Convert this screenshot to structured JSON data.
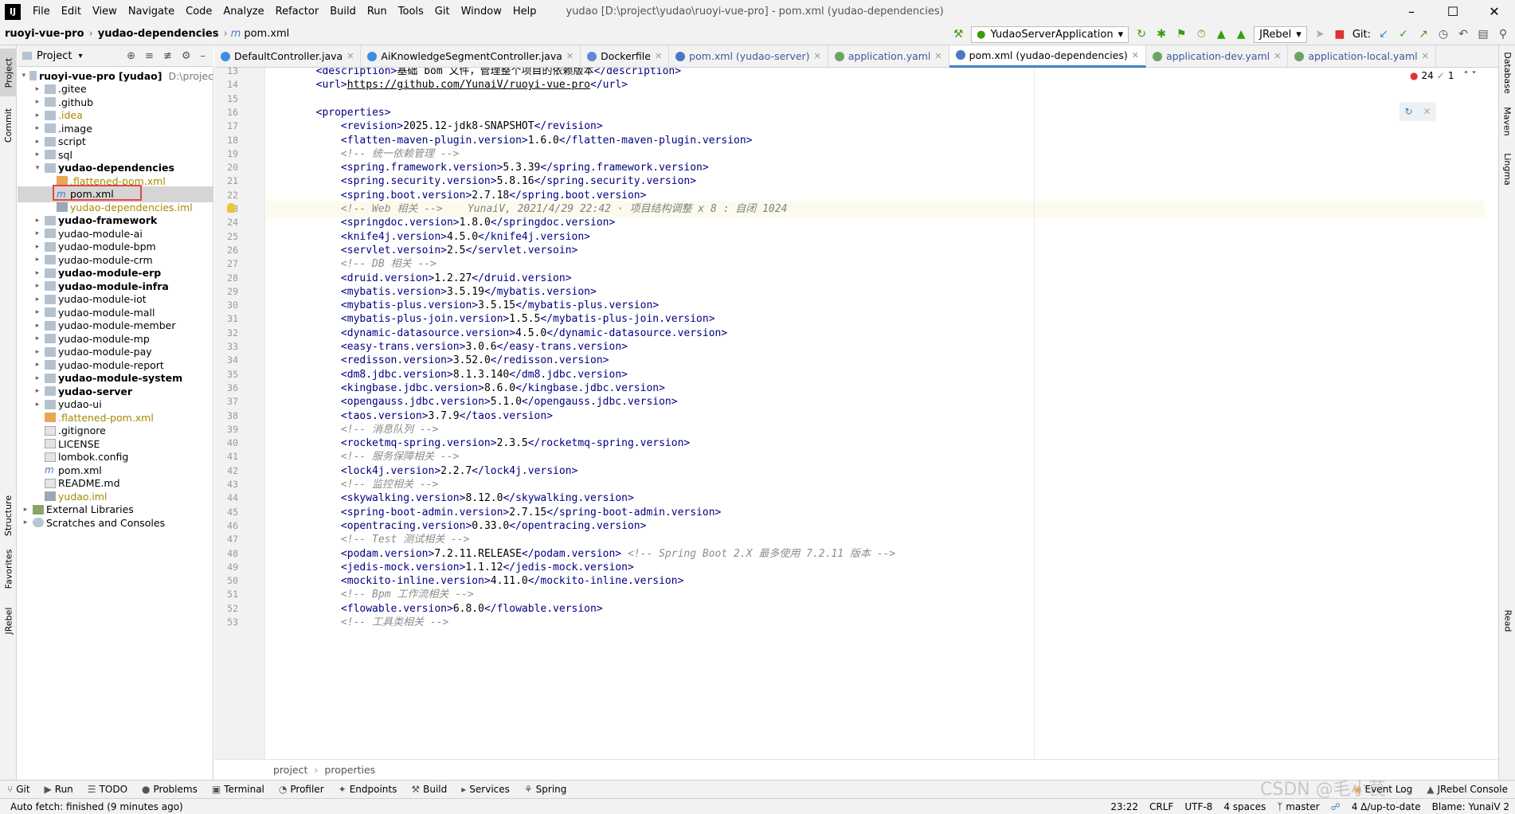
{
  "menubar": {
    "logo": "IJ",
    "items": [
      "File",
      "Edit",
      "View",
      "Navigate",
      "Code",
      "Analyze",
      "Refactor",
      "Build",
      "Run",
      "Tools",
      "Git",
      "Window",
      "Help"
    ],
    "title": "yudao [D:\\project\\yudao\\ruoyi-vue-pro] - pom.xml (yudao-dependencies)"
  },
  "navbar": {
    "crumbs": [
      "ruoyi-vue-pro",
      "yudao-dependencies",
      "pom.xml"
    ],
    "run_config": "YudaoServerApplication",
    "jrebel": "JRebel",
    "git_label": "Git:"
  },
  "left_strip": {
    "tabs": [
      "Project",
      "Commit",
      "Structure",
      "Favorites",
      "JRebel"
    ]
  },
  "right_strip": {
    "tabs": [
      "Database",
      "Maven",
      "Lingma",
      "Read"
    ]
  },
  "project_panel": {
    "title": "Project"
  },
  "tree": [
    {
      "label": "ruoyi-vue-pro [yudao]",
      "suffix": "D:\\projec",
      "depth": 0,
      "arrow": "open",
      "kind": "folder",
      "style": "bold"
    },
    {
      "label": ".gitee",
      "depth": 1,
      "arrow": "closed",
      "kind": "folder",
      "style": ""
    },
    {
      "label": ".github",
      "depth": 1,
      "arrow": "closed",
      "kind": "folder",
      "style": ""
    },
    {
      "label": ".idea",
      "depth": 1,
      "arrow": "closed",
      "kind": "folder",
      "style": "olive"
    },
    {
      "label": ".image",
      "depth": 1,
      "arrow": "closed",
      "kind": "folder",
      "style": ""
    },
    {
      "label": "script",
      "depth": 1,
      "arrow": "closed",
      "kind": "folder",
      "style": ""
    },
    {
      "label": "sql",
      "depth": 1,
      "arrow": "closed",
      "kind": "folder",
      "style": ""
    },
    {
      "label": "yudao-dependencies",
      "depth": 1,
      "arrow": "open",
      "kind": "folder",
      "style": "bold"
    },
    {
      "label": ".flattened-pom.xml",
      "depth": 2,
      "arrow": "",
      "kind": "xml",
      "style": "olive"
    },
    {
      "label": "pom.xml",
      "depth": 2,
      "arrow": "",
      "kind": "maven",
      "style": "",
      "selected": true
    },
    {
      "label": "yudao-dependencies.iml",
      "depth": 2,
      "arrow": "",
      "kind": "iml",
      "style": "olive"
    },
    {
      "label": "yudao-framework",
      "depth": 1,
      "arrow": "closed",
      "kind": "folder",
      "style": "bold"
    },
    {
      "label": "yudao-module-ai",
      "depth": 1,
      "arrow": "closed",
      "kind": "folder",
      "style": ""
    },
    {
      "label": "yudao-module-bpm",
      "depth": 1,
      "arrow": "closed",
      "kind": "folder",
      "style": ""
    },
    {
      "label": "yudao-module-crm",
      "depth": 1,
      "arrow": "closed",
      "kind": "folder",
      "style": ""
    },
    {
      "label": "yudao-module-erp",
      "depth": 1,
      "arrow": "closed",
      "kind": "folder",
      "style": "bold"
    },
    {
      "label": "yudao-module-infra",
      "depth": 1,
      "arrow": "closed",
      "kind": "folder",
      "style": "bold"
    },
    {
      "label": "yudao-module-iot",
      "depth": 1,
      "arrow": "closed",
      "kind": "folder",
      "style": ""
    },
    {
      "label": "yudao-module-mall",
      "depth": 1,
      "arrow": "closed",
      "kind": "folder",
      "style": ""
    },
    {
      "label": "yudao-module-member",
      "depth": 1,
      "arrow": "closed",
      "kind": "folder",
      "style": ""
    },
    {
      "label": "yudao-module-mp",
      "depth": 1,
      "arrow": "closed",
      "kind": "folder",
      "style": ""
    },
    {
      "label": "yudao-module-pay",
      "depth": 1,
      "arrow": "closed",
      "kind": "folder",
      "style": ""
    },
    {
      "label": "yudao-module-report",
      "depth": 1,
      "arrow": "closed",
      "kind": "folder",
      "style": ""
    },
    {
      "label": "yudao-module-system",
      "depth": 1,
      "arrow": "closed",
      "kind": "folder",
      "style": "bold"
    },
    {
      "label": "yudao-server",
      "depth": 1,
      "arrow": "closed",
      "kind": "folder",
      "style": "bold"
    },
    {
      "label": "yudao-ui",
      "depth": 1,
      "arrow": "closed",
      "kind": "folder",
      "style": ""
    },
    {
      "label": ".flattened-pom.xml",
      "depth": 1,
      "arrow": "",
      "kind": "xml",
      "style": "olive"
    },
    {
      "label": ".gitignore",
      "depth": 1,
      "arrow": "",
      "kind": "file",
      "style": ""
    },
    {
      "label": "LICENSE",
      "depth": 1,
      "arrow": "",
      "kind": "file",
      "style": ""
    },
    {
      "label": "lombok.config",
      "depth": 1,
      "arrow": "",
      "kind": "file",
      "style": ""
    },
    {
      "label": "pom.xml",
      "depth": 1,
      "arrow": "",
      "kind": "maven",
      "style": ""
    },
    {
      "label": "README.md",
      "depth": 1,
      "arrow": "",
      "kind": "file",
      "style": ""
    },
    {
      "label": "yudao.iml",
      "depth": 1,
      "arrow": "",
      "kind": "iml",
      "style": "olive"
    },
    {
      "label": "External Libraries",
      "depth": 0,
      "arrow": "closed",
      "kind": "lib",
      "style": ""
    },
    {
      "label": "Scratches and Consoles",
      "depth": 0,
      "arrow": "closed",
      "kind": "scratch",
      "style": ""
    }
  ],
  "tabs": [
    {
      "label": "DefaultController.java",
      "active": false,
      "icon": "#3d8ee0"
    },
    {
      "label": "AiKnowledgeSegmentController.java",
      "active": false,
      "icon": "#3d8ee0"
    },
    {
      "label": "Dockerfile",
      "active": false,
      "icon": "#5b8bd6"
    },
    {
      "label": "pom.xml (yudao-server)",
      "active": false,
      "icon": "#4a78c2"
    },
    {
      "label": "application.yaml",
      "active": false,
      "icon": "#6da55f"
    },
    {
      "label": "pom.xml (yudao-dependencies)",
      "active": true,
      "icon": "#4a78c2"
    },
    {
      "label": "application-dev.yaml",
      "active": false,
      "icon": "#6da55f"
    },
    {
      "label": "application-local.yaml",
      "active": false,
      "icon": "#6da55f"
    }
  ],
  "inspection": {
    "errors": "24",
    "warnings": "1"
  },
  "code_lines": [
    {
      "n": "13",
      "parts": [
        [
          "ind",
          "        "
        ],
        [
          "tg",
          "<description>"
        ],
        [
          "vl",
          "基础 bom 文件，管理整个项目的依赖版本"
        ],
        [
          "tg",
          "</description>"
        ]
      ]
    },
    {
      "n": "14",
      "parts": [
        [
          "ind",
          "        "
        ],
        [
          "tg",
          "<url>"
        ],
        [
          "vl",
          "https://github.com/YunaiV/ruoyi-vue-pro"
        ],
        [
          "tg",
          "</url>"
        ]
      ]
    },
    {
      "n": "15",
      "parts": []
    },
    {
      "n": "16",
      "parts": [
        [
          "ind",
          "        "
        ],
        [
          "tg",
          "<properties>"
        ]
      ]
    },
    {
      "n": "17",
      "parts": [
        [
          "ind",
          "            "
        ],
        [
          "tg",
          "<revision>"
        ],
        [
          "vl",
          "2025.12-jdk8-SNAPSHOT"
        ],
        [
          "tg",
          "</revision>"
        ]
      ]
    },
    {
      "n": "18",
      "parts": [
        [
          "ind",
          "            "
        ],
        [
          "tg",
          "<flatten-maven-plugin.version>"
        ],
        [
          "vl",
          "1.6.0"
        ],
        [
          "tg",
          "</flatten-maven-plugin.version>"
        ]
      ]
    },
    {
      "n": "19",
      "parts": [
        [
          "ind",
          "            "
        ],
        [
          "cm",
          "<!-- 统一依赖管理 -->"
        ]
      ]
    },
    {
      "n": "20",
      "parts": [
        [
          "ind",
          "            "
        ],
        [
          "tg",
          "<spring.framework.version>"
        ],
        [
          "vl",
          "5.3.39"
        ],
        [
          "tg",
          "</spring.framework.version>"
        ]
      ]
    },
    {
      "n": "21",
      "parts": [
        [
          "ind",
          "            "
        ],
        [
          "tg",
          "<spring.security.version>"
        ],
        [
          "vl",
          "5.8.16"
        ],
        [
          "tg",
          "</spring.security.version>"
        ]
      ]
    },
    {
      "n": "22",
      "parts": [
        [
          "ind",
          "            "
        ],
        [
          "tg",
          "<spring.boot.version>"
        ],
        [
          "vl",
          "2.7.18"
        ],
        [
          "tg",
          "</spring.boot.version>"
        ]
      ]
    },
    {
      "n": "23",
      "cur": true,
      "parts": [
        [
          "ind",
          "            "
        ],
        [
          "cm",
          "<!-- Web 相关 -->"
        ],
        [
          "bl",
          "    YunaiV, 2021/4/29 22:42 · 项目结构调整 x 8 : 自闭 1024"
        ]
      ]
    },
    {
      "n": "24",
      "parts": [
        [
          "ind",
          "            "
        ],
        [
          "tg",
          "<springdoc.version>"
        ],
        [
          "vl",
          "1.8.0"
        ],
        [
          "tg",
          "</springdoc.version>"
        ]
      ]
    },
    {
      "n": "25",
      "parts": [
        [
          "ind",
          "            "
        ],
        [
          "tg",
          "<knife4j.version>"
        ],
        [
          "vl",
          "4.5.0"
        ],
        [
          "tg",
          "</knife4j.version>"
        ]
      ]
    },
    {
      "n": "26",
      "parts": [
        [
          "ind",
          "            "
        ],
        [
          "tg",
          "<servlet.versoin>"
        ],
        [
          "vl",
          "2.5"
        ],
        [
          "tg",
          "</servlet.versoin>"
        ]
      ]
    },
    {
      "n": "27",
      "parts": [
        [
          "ind",
          "            "
        ],
        [
          "cm",
          "<!-- DB 相关 -->"
        ]
      ]
    },
    {
      "n": "28",
      "parts": [
        [
          "ind",
          "            "
        ],
        [
          "tg",
          "<druid.version>"
        ],
        [
          "vl",
          "1.2.27"
        ],
        [
          "tg",
          "</druid.version>"
        ]
      ]
    },
    {
      "n": "29",
      "parts": [
        [
          "ind",
          "            "
        ],
        [
          "tg",
          "<mybatis.version>"
        ],
        [
          "vl",
          "3.5.19"
        ],
        [
          "tg",
          "</mybatis.version>"
        ]
      ]
    },
    {
      "n": "30",
      "parts": [
        [
          "ind",
          "            "
        ],
        [
          "tg",
          "<mybatis-plus.version>"
        ],
        [
          "vl",
          "3.5.15"
        ],
        [
          "tg",
          "</mybatis-plus.version>"
        ]
      ]
    },
    {
      "n": "31",
      "parts": [
        [
          "ind",
          "            "
        ],
        [
          "tg",
          "<mybatis-plus-join.version>"
        ],
        [
          "vl",
          "1.5.5"
        ],
        [
          "tg",
          "</mybatis-plus-join.version>"
        ]
      ]
    },
    {
      "n": "32",
      "parts": [
        [
          "ind",
          "            "
        ],
        [
          "tg",
          "<dynamic-datasource.version>"
        ],
        [
          "vl",
          "4.5.0"
        ],
        [
          "tg",
          "</dynamic-datasource.version>"
        ]
      ]
    },
    {
      "n": "33",
      "parts": [
        [
          "ind",
          "            "
        ],
        [
          "tg",
          "<easy-trans.version>"
        ],
        [
          "vl",
          "3.0.6"
        ],
        [
          "tg",
          "</easy-trans.version>"
        ]
      ]
    },
    {
      "n": "34",
      "parts": [
        [
          "ind",
          "            "
        ],
        [
          "tg",
          "<redisson.version>"
        ],
        [
          "vl",
          "3.52.0"
        ],
        [
          "tg",
          "</redisson.version>"
        ]
      ]
    },
    {
      "n": "35",
      "parts": [
        [
          "ind",
          "            "
        ],
        [
          "tg",
          "<dm8.jdbc.version>"
        ],
        [
          "vl",
          "8.1.3.140"
        ],
        [
          "tg",
          "</dm8.jdbc.version>"
        ]
      ]
    },
    {
      "n": "36",
      "parts": [
        [
          "ind",
          "            "
        ],
        [
          "tg",
          "<kingbase.jdbc.version>"
        ],
        [
          "vl",
          "8.6.0"
        ],
        [
          "tg",
          "</kingbase.jdbc.version>"
        ]
      ]
    },
    {
      "n": "37",
      "parts": [
        [
          "ind",
          "            "
        ],
        [
          "tg",
          "<opengauss.jdbc.version>"
        ],
        [
          "vl",
          "5.1.0"
        ],
        [
          "tg",
          "</opengauss.jdbc.version>"
        ]
      ]
    },
    {
      "n": "38",
      "parts": [
        [
          "ind",
          "            "
        ],
        [
          "tg",
          "<taos.version>"
        ],
        [
          "vl",
          "3.7.9"
        ],
        [
          "tg",
          "</taos.version>"
        ]
      ]
    },
    {
      "n": "39",
      "parts": [
        [
          "ind",
          "            "
        ],
        [
          "cm",
          "<!-- 消息队列 -->"
        ]
      ]
    },
    {
      "n": "40",
      "parts": [
        [
          "ind",
          "            "
        ],
        [
          "tg",
          "<rocketmq-spring.version>"
        ],
        [
          "vl",
          "2.3.5"
        ],
        [
          "tg",
          "</rocketmq-spring.version>"
        ]
      ]
    },
    {
      "n": "41",
      "parts": [
        [
          "ind",
          "            "
        ],
        [
          "cm",
          "<!-- 服务保障相关 -->"
        ]
      ]
    },
    {
      "n": "42",
      "parts": [
        [
          "ind",
          "            "
        ],
        [
          "tg",
          "<lock4j.version>"
        ],
        [
          "vl",
          "2.2.7"
        ],
        [
          "tg",
          "</lock4j.version>"
        ]
      ]
    },
    {
      "n": "43",
      "parts": [
        [
          "ind",
          "            "
        ],
        [
          "cm",
          "<!-- 监控相关 -->"
        ]
      ]
    },
    {
      "n": "44",
      "parts": [
        [
          "ind",
          "            "
        ],
        [
          "tg",
          "<skywalking.version>"
        ],
        [
          "vl",
          "8.12.0"
        ],
        [
          "tg",
          "</skywalking.version>"
        ]
      ]
    },
    {
      "n": "45",
      "parts": [
        [
          "ind",
          "            "
        ],
        [
          "tg",
          "<spring-boot-admin.version>"
        ],
        [
          "vl",
          "2.7.15"
        ],
        [
          "tg",
          "</spring-boot-admin.version>"
        ]
      ]
    },
    {
      "n": "46",
      "parts": [
        [
          "ind",
          "            "
        ],
        [
          "tg",
          "<opentracing.version>"
        ],
        [
          "vl",
          "0.33.0"
        ],
        [
          "tg",
          "</opentracing.version>"
        ]
      ]
    },
    {
      "n": "47",
      "parts": [
        [
          "ind",
          "            "
        ],
        [
          "cm",
          "<!-- Test 测试相关 -->"
        ]
      ]
    },
    {
      "n": "48",
      "parts": [
        [
          "ind",
          "            "
        ],
        [
          "tg",
          "<podam.version>"
        ],
        [
          "vl",
          "7.2.11.RELEASE"
        ],
        [
          "tg",
          "</podam.version>"
        ],
        [
          "cm",
          " <!-- Spring Boot 2.X 最多使用 7.2.11 版本 -->"
        ]
      ]
    },
    {
      "n": "49",
      "parts": [
        [
          "ind",
          "            "
        ],
        [
          "tg",
          "<jedis-mock.version>"
        ],
        [
          "vl",
          "1.1.12"
        ],
        [
          "tg",
          "</jedis-mock.version>"
        ]
      ]
    },
    {
      "n": "50",
      "parts": [
        [
          "ind",
          "            "
        ],
        [
          "tg",
          "<mockito-inline.version>"
        ],
        [
          "vl",
          "4.11.0"
        ],
        [
          "tg",
          "</mockito-inline.version>"
        ]
      ]
    },
    {
      "n": "51",
      "parts": [
        [
          "ind",
          "            "
        ],
        [
          "cm",
          "<!-- Bpm 工作流相关 -->"
        ]
      ]
    },
    {
      "n": "52",
      "parts": [
        [
          "ind",
          "            "
        ],
        [
          "tg",
          "<flowable.version>"
        ],
        [
          "vl",
          "6.8.0"
        ],
        [
          "tg",
          "</flowable.version>"
        ]
      ]
    },
    {
      "n": "53",
      "parts": [
        [
          "ind",
          "            "
        ],
        [
          "cm",
          "<!-- 工具类相关 -->"
        ]
      ]
    }
  ],
  "code_crumbs": [
    "project",
    "properties"
  ],
  "tool_windows": [
    "Git",
    "Run",
    "TODO",
    "Problems",
    "Terminal",
    "Profiler",
    "Endpoints",
    "Build",
    "Services",
    "Spring"
  ],
  "tool_windows_right": [
    "Event Log",
    "JRebel Console"
  ],
  "status": {
    "message": "Auto fetch: finished (9 minutes ago)",
    "position": "23:22",
    "line_sep": "CRLF",
    "encoding": "UTF-8",
    "indent": "4 spaces",
    "branch": "master",
    "updates": "4 Δ/up-to-date",
    "blame": "Blame: YunaiV 2"
  },
  "watermark": "CSDN @毛小茛"
}
